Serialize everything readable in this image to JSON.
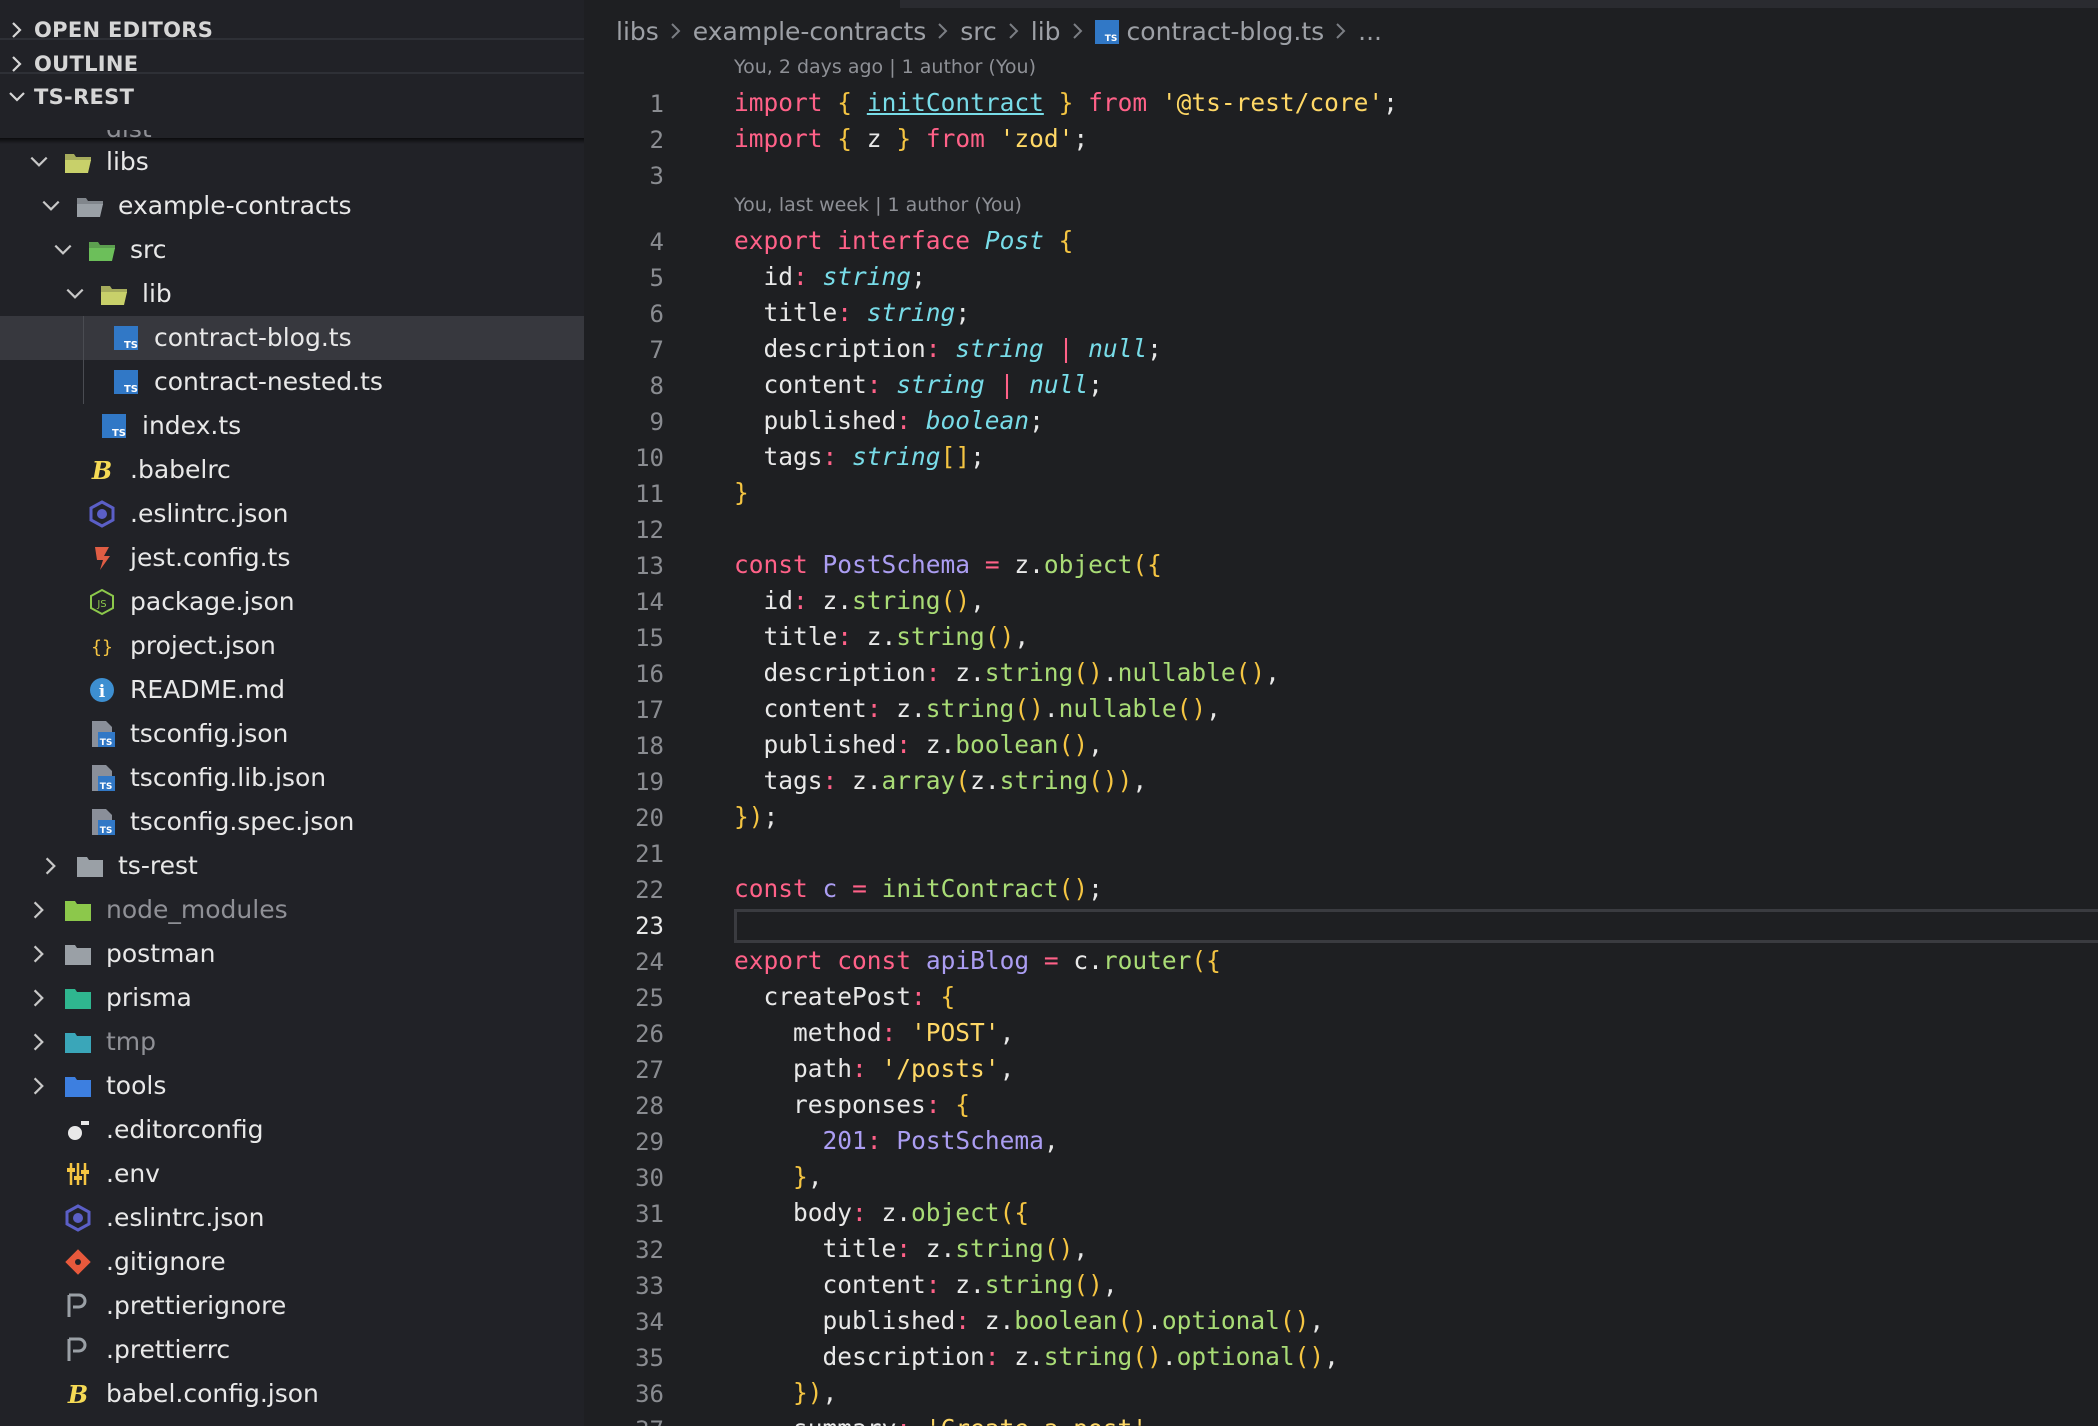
{
  "sidebar": {
    "sections": {
      "open_editors": "OPEN EDITORS",
      "outline": "OUTLINE",
      "project": "TS-REST"
    },
    "peek_item": "dist",
    "tree": [
      {
        "label": "libs",
        "depth": 1,
        "kind": "folder-open",
        "chev": "down",
        "icon": "folder-libs-open-icon",
        "color": "#c8d06a"
      },
      {
        "label": "example-contracts",
        "depth": 2,
        "kind": "folder-open",
        "chev": "down",
        "icon": "folder-open-icon",
        "color": "#9aa0a6"
      },
      {
        "label": "src",
        "depth": 3,
        "kind": "folder-open",
        "chev": "down",
        "icon": "folder-src-open-icon",
        "color": "#6cbf5a"
      },
      {
        "label": "lib",
        "depth": 4,
        "kind": "folder-open",
        "chev": "down",
        "icon": "folder-lib-open-icon",
        "color": "#c8d06a"
      },
      {
        "label": "contract-blog.ts",
        "depth": 5,
        "kind": "file",
        "icon": "typescript-file-icon",
        "color": "#3178c6",
        "selected": true
      },
      {
        "label": "contract-nested.ts",
        "depth": 5,
        "kind": "file",
        "icon": "typescript-file-icon",
        "color": "#3178c6"
      },
      {
        "label": "index.ts",
        "depth": 4,
        "kind": "file",
        "icon": "typescript-file-icon",
        "color": "#3178c6"
      },
      {
        "label": ".babelrc",
        "depth": 3,
        "kind": "file",
        "icon": "babel-icon",
        "color": "#f5da55"
      },
      {
        "label": ".eslintrc.json",
        "depth": 3,
        "kind": "file",
        "icon": "eslint-icon",
        "color": "#5b5fc7"
      },
      {
        "label": "jest.config.ts",
        "depth": 3,
        "kind": "file",
        "icon": "jest-icon",
        "color": "#e05d44"
      },
      {
        "label": "package.json",
        "depth": 3,
        "kind": "file",
        "icon": "nodejs-icon",
        "color": "#8cc84b"
      },
      {
        "label": "project.json",
        "depth": 3,
        "kind": "file",
        "icon": "json-braces-icon",
        "color": "#f5c542"
      },
      {
        "label": "README.md",
        "depth": 3,
        "kind": "file",
        "icon": "info-icon",
        "color": "#3d8fd1"
      },
      {
        "label": "tsconfig.json",
        "depth": 3,
        "kind": "file",
        "icon": "tsconfig-icon",
        "color": "#3178c6"
      },
      {
        "label": "tsconfig.lib.json",
        "depth": 3,
        "kind": "file",
        "icon": "tsconfig-icon",
        "color": "#3178c6"
      },
      {
        "label": "tsconfig.spec.json",
        "depth": 3,
        "kind": "file",
        "icon": "tsconfig-icon",
        "color": "#3178c6"
      },
      {
        "label": "ts-rest",
        "depth": 2,
        "kind": "folder",
        "chev": "right",
        "icon": "folder-icon",
        "color": "#9aa0a6"
      },
      {
        "label": "node_modules",
        "depth": 1,
        "kind": "folder",
        "chev": "right",
        "icon": "folder-node-icon",
        "color": "#8cc84b",
        "dim": true
      },
      {
        "label": "postman",
        "depth": 1,
        "kind": "folder",
        "chev": "right",
        "icon": "folder-icon",
        "color": "#9aa0a6"
      },
      {
        "label": "prisma",
        "depth": 1,
        "kind": "folder",
        "chev": "right",
        "icon": "folder-prisma-icon",
        "color": "#2fb68f"
      },
      {
        "label": "tmp",
        "depth": 1,
        "kind": "folder",
        "chev": "right",
        "icon": "folder-temp-icon",
        "color": "#3aa6b9",
        "dim": true
      },
      {
        "label": "tools",
        "depth": 1,
        "kind": "folder",
        "chev": "right",
        "icon": "folder-tools-icon",
        "color": "#3d7fe0"
      },
      {
        "label": ".editorconfig",
        "depth": 1,
        "kind": "file",
        "icon": "editorconfig-icon",
        "color": "#e8e8e8"
      },
      {
        "label": ".env",
        "depth": 1,
        "kind": "file",
        "icon": "env-icon",
        "color": "#f5c542"
      },
      {
        "label": ".eslintrc.json",
        "depth": 1,
        "kind": "file",
        "icon": "eslint-icon",
        "color": "#5b5fc7"
      },
      {
        "label": ".gitignore",
        "depth": 1,
        "kind": "file",
        "icon": "git-icon",
        "color": "#e8593c"
      },
      {
        "label": ".prettierignore",
        "depth": 1,
        "kind": "file",
        "icon": "prettier-icon",
        "color": "#9aa0a6"
      },
      {
        "label": ".prettierrc",
        "depth": 1,
        "kind": "file",
        "icon": "prettier-icon",
        "color": "#9aa0a6"
      },
      {
        "label": "babel.config.json",
        "depth": 1,
        "kind": "file",
        "icon": "babel-icon",
        "color": "#f5da55"
      }
    ]
  },
  "editor": {
    "breadcrumb": [
      "libs",
      "example-contracts",
      "src",
      "lib",
      "contract-blog.ts",
      "..."
    ],
    "codelens": [
      {
        "before_line": 1,
        "text": "You, 2 days ago | 1 author (You)"
      },
      {
        "before_line": 4,
        "text": "You, last week | 1 author (You)"
      }
    ],
    "active_line": 23,
    "lines": [
      "import { initContract } from '@ts-rest/core';",
      "import { z } from 'zod';",
      "",
      "export interface Post {",
      "  id: string;",
      "  title: string;",
      "  description: string | null;",
      "  content: string | null;",
      "  published: boolean;",
      "  tags: string[];",
      "}",
      "",
      "const PostSchema = z.object({",
      "  id: z.string(),",
      "  title: z.string(),",
      "  description: z.string().nullable(),",
      "  content: z.string().nullable(),",
      "  published: z.boolean(),",
      "  tags: z.array(z.string()),",
      "});",
      "",
      "const c = initContract();",
      "",
      "export const apiBlog = c.router({",
      "  createPost: {",
      "    method: 'POST',",
      "    path: '/posts',",
      "    responses: {",
      "      201: PostSchema,",
      "    },",
      "    body: z.object({",
      "      title: z.string(),",
      "      content: z.string(),",
      "      published: z.boolean().optional(),",
      "      description: z.string().optional(),",
      "    }),",
      "    summary: 'Create a post',"
    ]
  },
  "colors": {
    "keyword": "#ff6188",
    "string": "#ffd866",
    "function": "#a9dc76",
    "type": "#78dce8",
    "constant": "#ab9df2"
  }
}
